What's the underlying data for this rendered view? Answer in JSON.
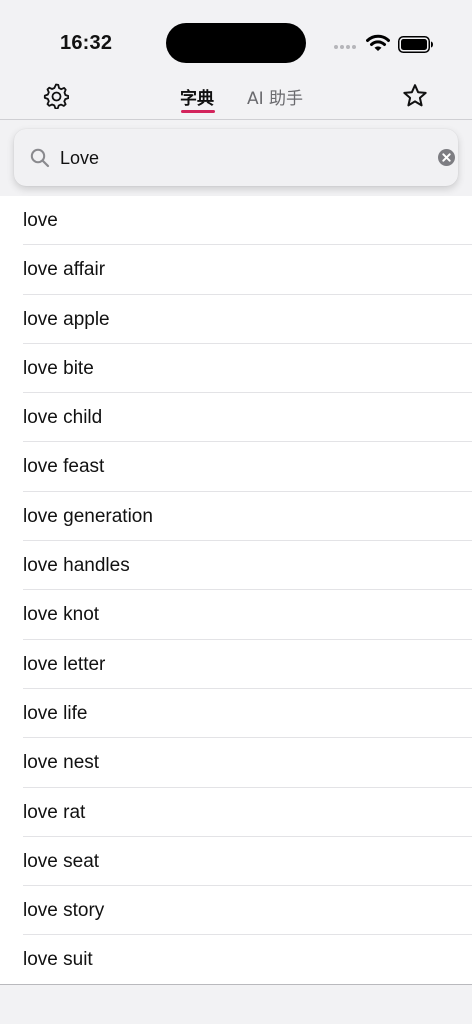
{
  "status_bar": {
    "time": "16:32"
  },
  "nav": {
    "settings_icon": "gear-icon",
    "favorites_icon": "star-icon",
    "tabs": [
      {
        "label": "字典",
        "active": true
      },
      {
        "label": "AI 助手",
        "active": false
      }
    ]
  },
  "search": {
    "value": "Love",
    "placeholder": ""
  },
  "results": [
    {
      "label": "love"
    },
    {
      "label": "love affair"
    },
    {
      "label": "love apple"
    },
    {
      "label": "love bite"
    },
    {
      "label": "love child"
    },
    {
      "label": "love feast"
    },
    {
      "label": "love generation"
    },
    {
      "label": "love handles"
    },
    {
      "label": "love knot"
    },
    {
      "label": "love letter"
    },
    {
      "label": "love life"
    },
    {
      "label": "love nest"
    },
    {
      "label": "love rat"
    },
    {
      "label": "love seat"
    },
    {
      "label": "love story"
    },
    {
      "label": "love suit"
    }
  ],
  "colors": {
    "accent": "#d3245c",
    "background": "#f2f2f4",
    "list_background": "#ffffff"
  }
}
